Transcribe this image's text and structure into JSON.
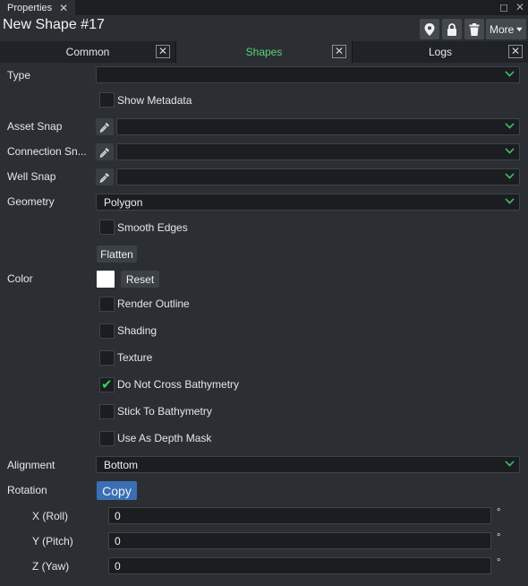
{
  "window": {
    "tab_label": "Properties",
    "close_glyph": "✕",
    "restore_glyph": "◻",
    "win_close_glyph": "✕"
  },
  "header": {
    "title": "New Shape #17",
    "more_label": "More",
    "icons": [
      "location-pin-icon",
      "lock-icon",
      "trash-icon",
      "caret-down-icon"
    ]
  },
  "tabs": [
    {
      "label": "Common",
      "active": false
    },
    {
      "label": "Shapes",
      "active": true
    },
    {
      "label": "Logs",
      "active": false
    }
  ],
  "tab_close_glyph": "✕",
  "form": {
    "type": {
      "label": "Type",
      "value": ""
    },
    "show_metadata": {
      "label": "Show Metadata",
      "checked": false
    },
    "asset_snap": {
      "label": "Asset Snap",
      "value": ""
    },
    "connection_snap": {
      "label": "Connection Sn...",
      "value": ""
    },
    "well_snap": {
      "label": "Well Snap",
      "value": ""
    },
    "geometry": {
      "label": "Geometry",
      "value": "Polygon"
    },
    "smooth_edges": {
      "label": "Smooth Edges",
      "checked": false
    },
    "flatten_label": "Flatten",
    "color": {
      "label": "Color",
      "value": "#ffffff",
      "reset_label": "Reset"
    },
    "render_outline": {
      "label": "Render Outline",
      "checked": false
    },
    "shading": {
      "label": "Shading",
      "checked": false
    },
    "texture": {
      "label": "Texture",
      "checked": false
    },
    "do_not_cross": {
      "label": "Do Not Cross Bathymetry",
      "checked": true
    },
    "stick_to": {
      "label": "Stick To Bathymetry",
      "checked": false
    },
    "depth_mask": {
      "label": "Use As Depth Mask",
      "checked": false
    },
    "alignment": {
      "label": "Alignment",
      "value": "Bottom"
    },
    "rotation": {
      "label": "Rotation",
      "copy_label": "Copy",
      "x": {
        "label": "X (Roll)",
        "value": "0",
        "unit": "°"
      },
      "y": {
        "label": "Y (Pitch)",
        "value": "0",
        "unit": "°"
      },
      "z": {
        "label": "Z (Yaw)",
        "value": "0",
        "unit": "°"
      }
    }
  },
  "colors": {
    "accent_green": "#3fbf68",
    "copy_blue": "#3a6fb5",
    "bg": "#2b2f33"
  }
}
